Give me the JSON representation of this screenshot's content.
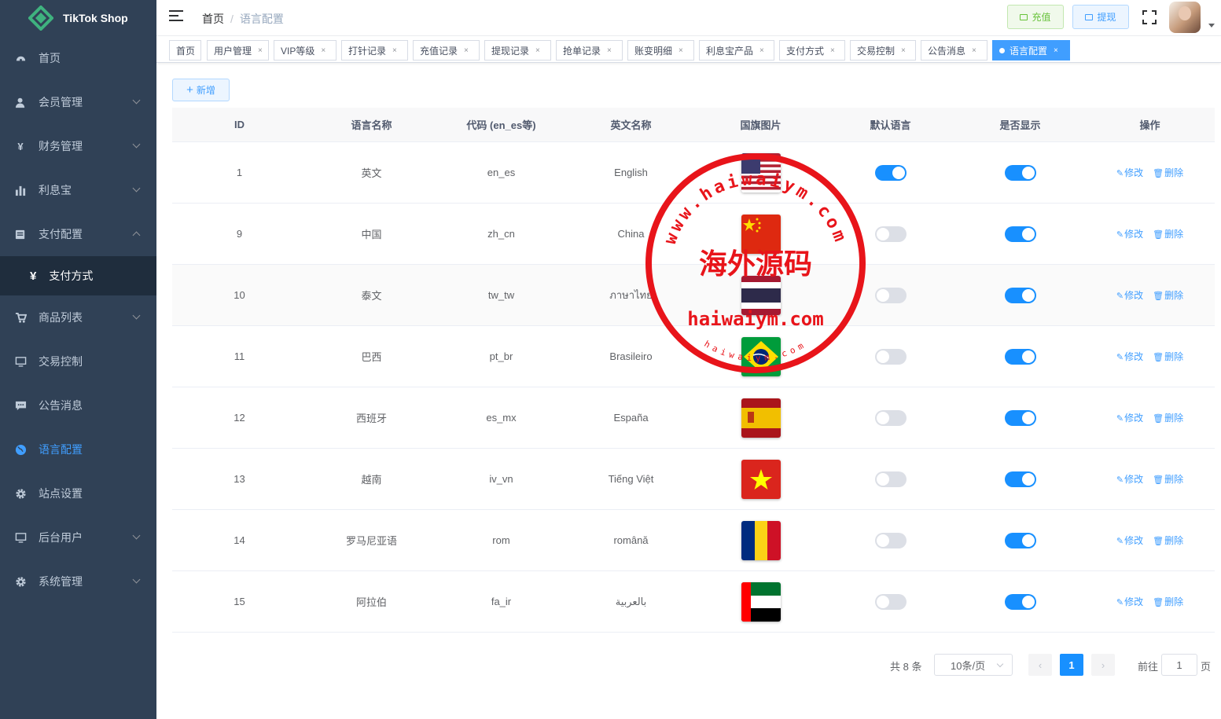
{
  "app": {
    "logo_text": "TikTok Shop"
  },
  "sidebar": {
    "items": [
      {
        "label": "首页",
        "icon": "dashboard-icon",
        "expandable": false
      },
      {
        "label": "会员管理",
        "icon": "user-icon",
        "expandable": true
      },
      {
        "label": "财务管理",
        "icon": "yen-icon",
        "expandable": true
      },
      {
        "label": "利息宝",
        "icon": "chart-icon",
        "expandable": true
      },
      {
        "label": "支付配置",
        "icon": "payment-config-icon",
        "expandable": true,
        "expanded": true
      },
      {
        "label": "支付方式",
        "icon": "yen-icon",
        "submenu": true
      },
      {
        "label": "商品列表",
        "icon": "cart-icon",
        "expandable": true
      },
      {
        "label": "交易控制",
        "icon": "monitor-icon",
        "expandable": false
      },
      {
        "label": "公告消息",
        "icon": "message-icon",
        "expandable": false
      },
      {
        "label": "语言配置",
        "icon": "globe-icon",
        "expandable": false,
        "active": true
      },
      {
        "label": "站点设置",
        "icon": "gear-icon",
        "expandable": false
      },
      {
        "label": "后台用户",
        "icon": "monitor-icon",
        "expandable": true
      },
      {
        "label": "系统管理",
        "icon": "gear-icon",
        "expandable": true
      }
    ]
  },
  "navbar": {
    "breadcrumb": [
      "首页",
      "语言配置"
    ],
    "recharge_label": "充值",
    "withdraw_label": "提现"
  },
  "tags": [
    {
      "label": "首页",
      "closable": false
    },
    {
      "label": "用户管理",
      "closable": true
    },
    {
      "label": "VIP等级",
      "closable": true
    },
    {
      "label": "打针记录",
      "closable": true
    },
    {
      "label": "充值记录",
      "closable": true
    },
    {
      "label": "提现记录",
      "closable": true
    },
    {
      "label": "抢单记录",
      "closable": true
    },
    {
      "label": "账变明细",
      "closable": true
    },
    {
      "label": "利息宝产品",
      "closable": true
    },
    {
      "label": "支付方式",
      "closable": true
    },
    {
      "label": "交易控制",
      "closable": true
    },
    {
      "label": "公告消息",
      "closable": true
    },
    {
      "label": "语言配置",
      "closable": true,
      "active": true
    }
  ],
  "toolbar": {
    "add_label": "新增"
  },
  "table": {
    "headers": [
      "ID",
      "语言名称",
      "代码 (en_es等)",
      "英文名称",
      "国旗图片",
      "默认语言",
      "是否显示",
      "操作"
    ],
    "edit_label": "修改",
    "delete_label": "删除",
    "rows": [
      {
        "id": "1",
        "name": "英文",
        "code": "en_es",
        "english": "English",
        "flag": "us",
        "default": true,
        "visible": true
      },
      {
        "id": "9",
        "name": "中国",
        "code": "zh_cn",
        "english": "China",
        "flag": "cn",
        "default": false,
        "visible": true
      },
      {
        "id": "10",
        "name": "泰文",
        "code": "tw_tw",
        "english": "ภาษาไทย",
        "flag": "th",
        "default": false,
        "visible": true
      },
      {
        "id": "11",
        "name": "巴西",
        "code": "pt_br",
        "english": "Brasileiro",
        "flag": "br",
        "default": false,
        "visible": true
      },
      {
        "id": "12",
        "name": "西班牙",
        "code": "es_mx",
        "english": "España",
        "flag": "es",
        "default": false,
        "visible": true
      },
      {
        "id": "13",
        "name": "越南",
        "code": "iv_vn",
        "english": "Tiếng Việt",
        "flag": "vn",
        "default": false,
        "visible": true
      },
      {
        "id": "14",
        "name": "罗马尼亚语",
        "code": "rom",
        "english": "română",
        "flag": "ro",
        "default": false,
        "visible": true
      },
      {
        "id": "15",
        "name": "阿拉伯",
        "code": "fa_ir",
        "english": "بالعربية",
        "flag": "ae",
        "default": false,
        "visible": true
      }
    ]
  },
  "pagination": {
    "total_text": "共 8 条",
    "page_size": "10条/页",
    "current_page": "1",
    "goto_label": "前往",
    "goto_value": "1",
    "page_suffix": "页"
  },
  "watermark": {
    "top_arc": "www.haiwaiym.com",
    "center": "海外源码",
    "domain": "haiwaiym.com",
    "bottom_arc": "haiwaiym.com"
  },
  "colors": {
    "sidebar_bg": "#304156",
    "accent": "#1890ff",
    "stamp": "#e8141a"
  }
}
